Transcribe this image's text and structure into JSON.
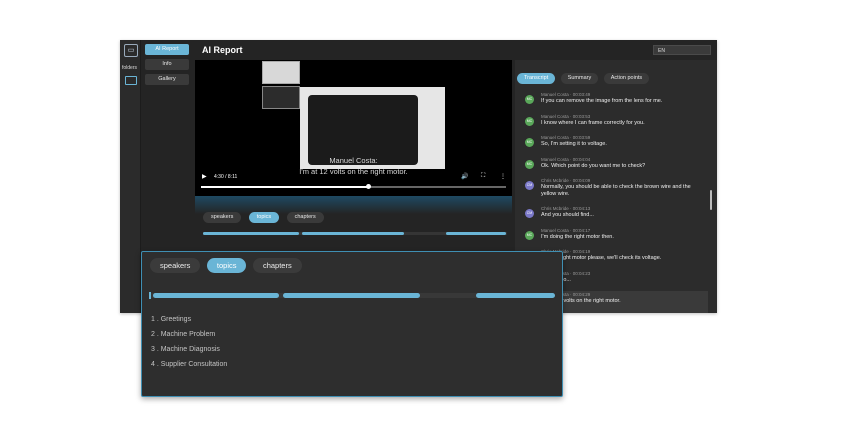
{
  "app": {
    "title": "AI Report",
    "language": "EN",
    "folders_label": "folders",
    "nav": [
      "AI Report",
      "Info",
      "Gallery"
    ]
  },
  "video": {
    "subtitle_speaker": "Manuel Costa:",
    "subtitle_text": "I'm at 12 volts on the right motor.",
    "time": "4:30 / 8:11",
    "progress_fraction": 0.55
  },
  "topic_tabs": [
    "speakers",
    "topics",
    "chapters"
  ],
  "panel_tabs": [
    "Transcript",
    "Summary",
    "Action points"
  ],
  "transcript": [
    {
      "initials": "MC",
      "speaker": "Manuel Costa",
      "time": "00:03:49",
      "text": "If you can remove the image from the lens for me.",
      "color": "#5aa85a"
    },
    {
      "initials": "MC",
      "speaker": "Manuel Costa",
      "time": "00:03:53",
      "text": "I know where I can frame correctly for you.",
      "color": "#5aa85a"
    },
    {
      "initials": "MC",
      "speaker": "Manuel Costa",
      "time": "00:03:59",
      "text": "So, I'm setting it to voltage.",
      "color": "#5aa85a"
    },
    {
      "initials": "MC",
      "speaker": "Manuel Costa",
      "time": "00:04:04",
      "text": "Ok. Which point do you want me to check?",
      "color": "#5aa85a"
    },
    {
      "initials": "CM",
      "speaker": "Chris Mcbride",
      "time": "00:04:09",
      "text": "Normally, you should be able to check the brown wire and the yellow wire.",
      "color": "#7a78c8"
    },
    {
      "initials": "CM",
      "speaker": "Chris Mcbride",
      "time": "00:04:13",
      "text": "And you should find...",
      "color": "#7a78c8"
    },
    {
      "initials": "MC",
      "speaker": "Manuel Costa",
      "time": "00:04:17",
      "text": "I'm doing the right motor then.",
      "color": "#5aa85a"
    },
    {
      "initials": "CM",
      "speaker": "Chris Mcbride",
      "time": "00:04:19",
      "text": "Put the right motor please, we'll check its voltage.",
      "color": "#7a78c8"
    },
    {
      "initials": "MC",
      "speaker": "Manuel Costa",
      "time": "00:04:23",
      "text": "Alright. So...",
      "color": "#5aa85a"
    },
    {
      "initials": "MC",
      "speaker": "Manuel Costa",
      "time": "00:04:29",
      "text": "I'm at 12 volts on the right motor.",
      "color": "#5aa85a"
    }
  ],
  "chapters": [
    "1 . Greetings",
    "2 . Machine Problem",
    "3 . Machine Diagnosis",
    "4 . Supplier Consultation"
  ],
  "colors": {
    "accent": "#6ab5d6",
    "background": "#242424",
    "panel": "#2c2c2c"
  }
}
